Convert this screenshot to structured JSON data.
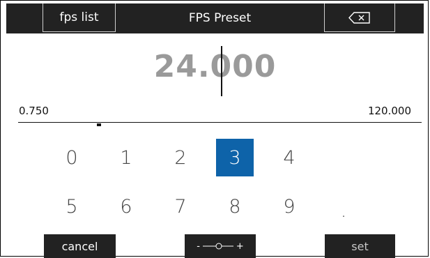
{
  "header": {
    "fps_list_label": "fps list",
    "title": "FPS Preset",
    "backspace_icon": "backspace-icon"
  },
  "entry": {
    "value": "24.000"
  },
  "range": {
    "min": "0.750",
    "max": "120.000"
  },
  "keypad": {
    "keys": [
      "0",
      "1",
      "2",
      "3",
      "4",
      "5",
      "6",
      "7",
      "8",
      "9",
      "."
    ],
    "selected": "3"
  },
  "footer": {
    "cancel_label": "cancel",
    "slider_minus": "-",
    "slider_plus": "+",
    "set_label": "set"
  },
  "colors": {
    "header_bg": "#222222",
    "selected_key": "#0e63a9",
    "value_text": "#9a9a9a"
  }
}
